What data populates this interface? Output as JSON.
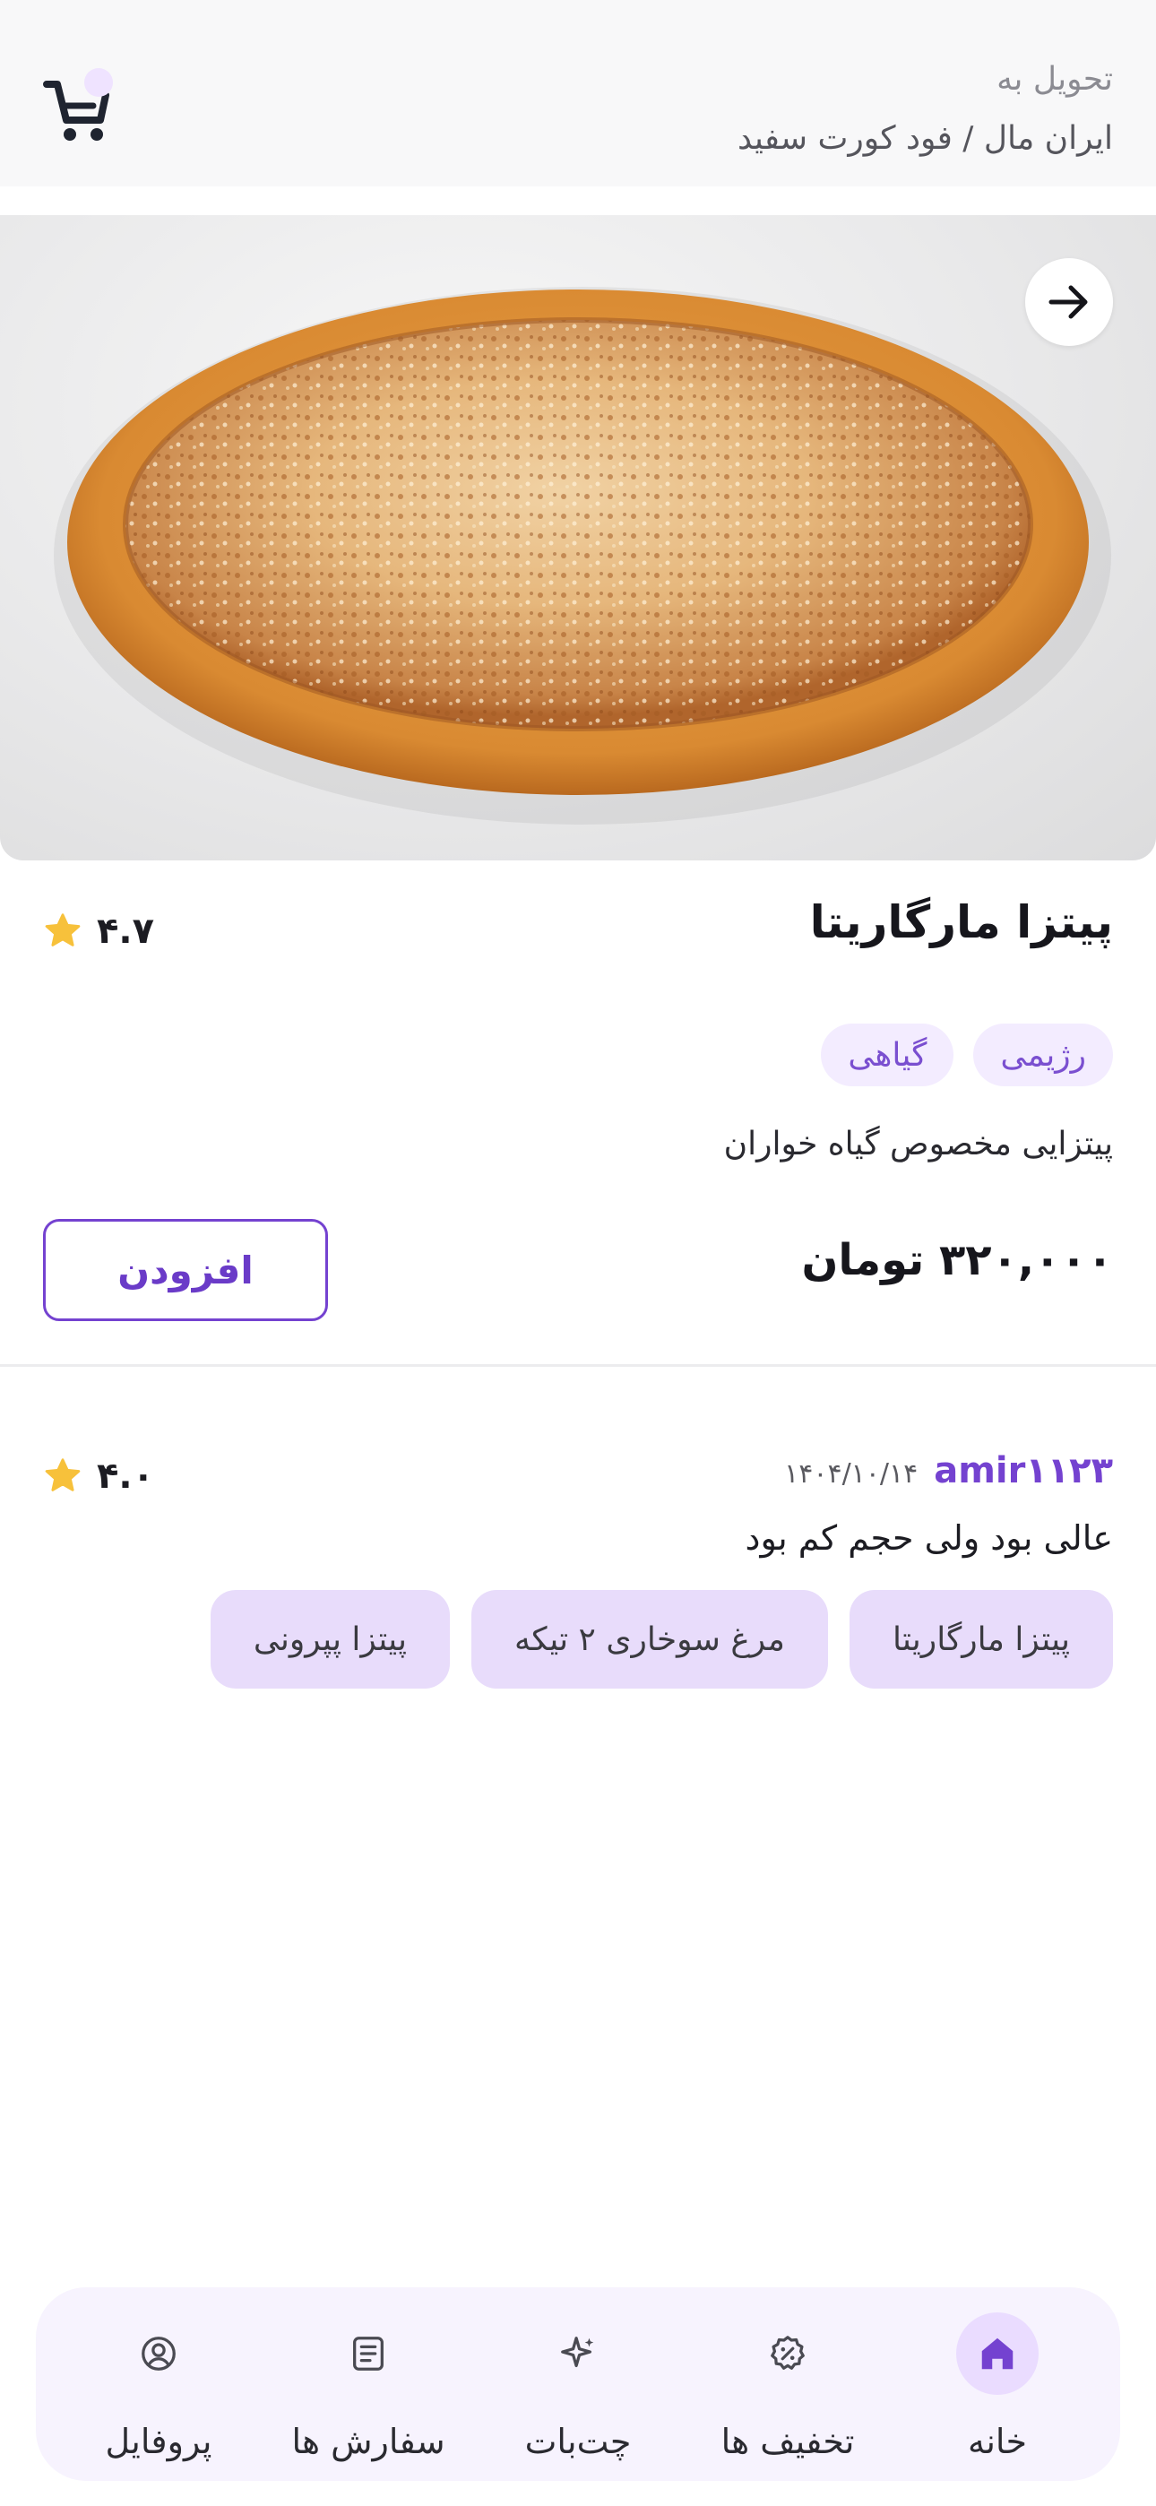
{
  "header": {
    "deliver_label": "تحویل به",
    "deliver_address": "ایران مال / فود کورت سفید",
    "cart_icon": "cart-icon"
  },
  "hero": {
    "back_icon": "arrow-right-icon",
    "image": "pizza-photo"
  },
  "product": {
    "title": "پیتزا مارگاریتا",
    "rating": "۴.۷",
    "tags": [
      "رژیمی",
      "گیاهی"
    ],
    "description": "پیتزایی مخصوص گیاه خواران",
    "price": "۳۲۰,۰۰۰ تومان",
    "add_label": "افزودن"
  },
  "review": {
    "user": "amir۱۱۲۳",
    "date": "۱۴۰۴/۱۰/۱۴",
    "rating": "۴.۰",
    "text": "عالی بود ولی حجم کم بود",
    "items": [
      "پیتزا مارگاریتا",
      "مرغ سوخاری ۲ تیکه",
      "پیتزا پپرونی"
    ]
  },
  "nav": {
    "items": [
      {
        "label": "خانه",
        "icon": "home-icon",
        "active": true
      },
      {
        "label": "تخفیف ها",
        "icon": "discount-icon",
        "active": false
      },
      {
        "label": "چت‌بات",
        "icon": "sparkle-icon",
        "active": false
      },
      {
        "label": "سفارش ها",
        "icon": "orders-icon",
        "active": false
      },
      {
        "label": "پروفایل",
        "icon": "profile-icon",
        "active": false
      }
    ]
  },
  "colors": {
    "accent": "#7442d0",
    "star": "#f7c13b",
    "tag_bg": "#f3ecff",
    "nav_bg": "#f7f3fe"
  }
}
